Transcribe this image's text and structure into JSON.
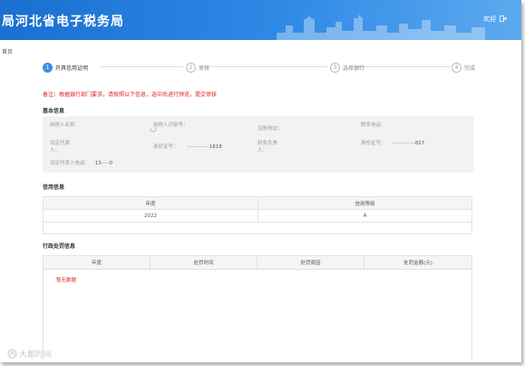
{
  "header": {
    "title": "局河北省电子税务局",
    "user_label": "欢迎"
  },
  "breadcrumb": "首页",
  "steps": [
    {
      "num": "1",
      "label": "开具信用证明",
      "state": "active"
    },
    {
      "num": "2",
      "label": "审核",
      "state": "idle"
    },
    {
      "num": "3",
      "label": "选择银行",
      "state": "idle"
    },
    {
      "num": "4",
      "label": "完成",
      "state": "idle"
    }
  ],
  "notice": "备注：根据银行部门要求，请按照以下信息，选中后进行预览，提交审核",
  "basic_info": {
    "section_title": "基本信息",
    "fields": {
      "taxpayer_name": {
        "label": "纳税人名称：",
        "value": ""
      },
      "taxpayer_id": {
        "label": "纳税人识别号：",
        "value": ""
      },
      "reg_address": {
        "label": "注册地址：",
        "value": ""
      },
      "phone": {
        "label": "联系电话：",
        "value": ""
      },
      "legal_rep": {
        "label": "法定代表人：",
        "value": ""
      },
      "id_no": {
        "label": "身份证号：",
        "value": "··············1818"
      },
      "finance_head": {
        "label": "财务负责人：",
        "value": ""
      },
      "finance_id": {
        "label": "身份证号：",
        "value": "··············827"
      },
      "agent": {
        "label": "法定代表人电话：",
        "value": "13·····0"
      }
    }
  },
  "credit_info": {
    "section_title": "信用信息",
    "headers": [
      "年度",
      "信用等级"
    ],
    "rows": [
      [
        "2022",
        "A"
      ]
    ]
  },
  "penalty_info": {
    "section_title": "行政处罚信息",
    "headers": [
      "年度",
      "处罚时间",
      "处罚原因",
      "处罚金额(元)"
    ],
    "empty_text": "暂无数据"
  },
  "watermark": "大都时间"
}
